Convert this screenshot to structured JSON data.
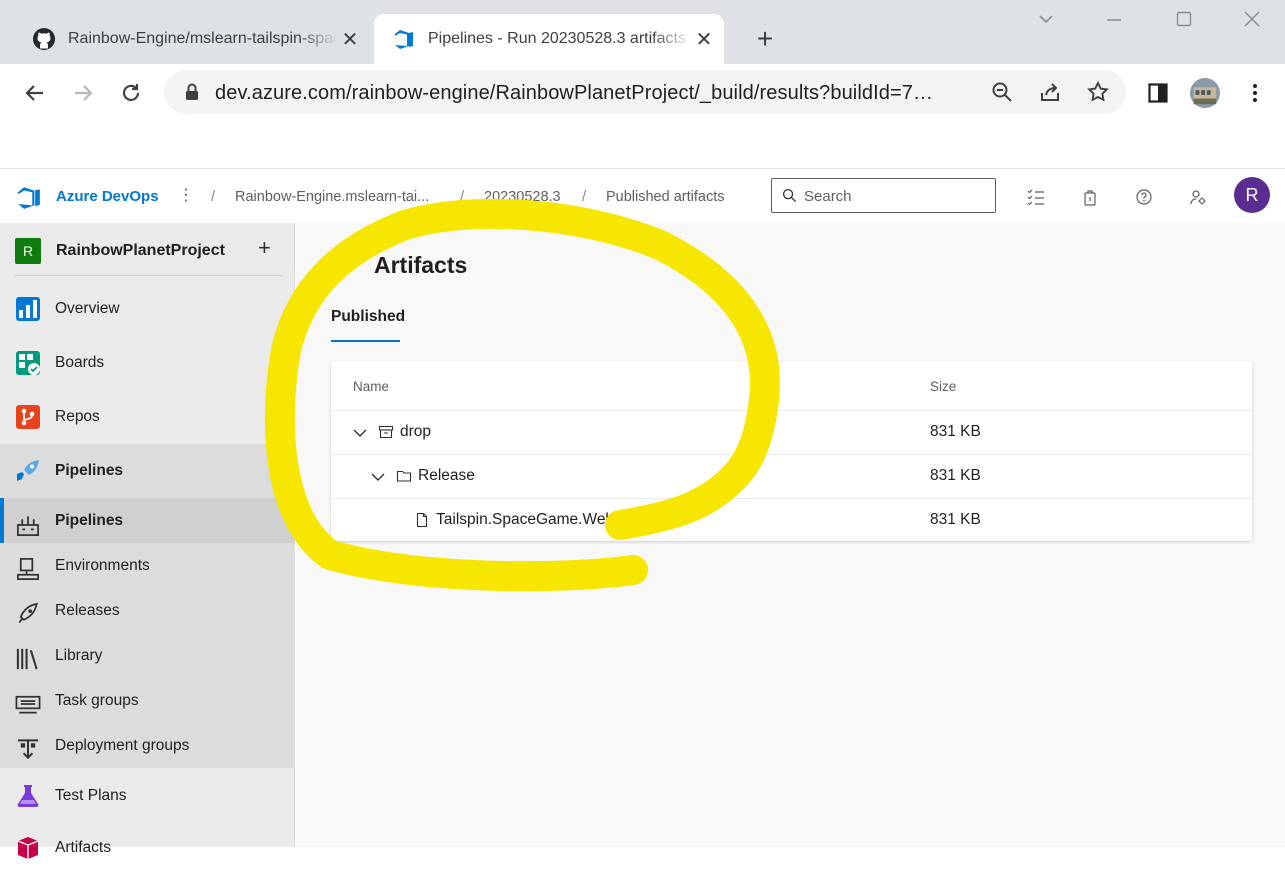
{
  "browser": {
    "tabs": [
      {
        "title": "Rainbow-Engine/mslearn-tailspin-spacegame-web",
        "close": "✕"
      },
      {
        "title": "Pipelines - Run 20230528.3 artifacts",
        "close": "✕"
      }
    ],
    "new_tab": "+",
    "url": "dev.azure.com/rainbow-engine/RainbowPlanetProject/_build/results?buildId=7…"
  },
  "header": {
    "brand": "Azure DevOps",
    "more": "⋮",
    "breadcrumbs": [
      "Rainbow-Engine.mslearn-tai...",
      "20230528.3",
      "Published artifacts"
    ],
    "separator": "/",
    "search_placeholder": "Search",
    "avatar_initial": "R"
  },
  "sidebar": {
    "project_initial": "R",
    "project_name": "RainbowPlanetProject",
    "project_add": "+",
    "items": [
      {
        "label": "Overview",
        "icon": "overview-icon"
      },
      {
        "label": "Boards",
        "icon": "boards-icon"
      },
      {
        "label": "Repos",
        "icon": "repos-icon"
      },
      {
        "label": "Pipelines",
        "icon": "pipelines-icon"
      },
      {
        "label": "Pipelines",
        "icon": "pipelines-sub-icon"
      },
      {
        "label": "Environments",
        "icon": "environments-icon"
      },
      {
        "label": "Releases",
        "icon": "releases-icon"
      },
      {
        "label": "Library",
        "icon": "library-icon"
      },
      {
        "label": "Task groups",
        "icon": "task-groups-icon"
      },
      {
        "label": "Deployment groups",
        "icon": "deployment-groups-icon"
      },
      {
        "label": "Test Plans",
        "icon": "test-plans-icon"
      },
      {
        "label": "Artifacts",
        "icon": "artifacts-icon"
      }
    ]
  },
  "main": {
    "title": "Artifacts",
    "tab": "Published",
    "columns": {
      "name": "Name",
      "size": "Size"
    },
    "rows": [
      {
        "name": "drop",
        "size": "831 KB",
        "icon": "artifact-box-icon",
        "expanded": true
      },
      {
        "name": "Release",
        "size": "831 KB",
        "icon": "folder-icon",
        "expanded": true
      },
      {
        "name": "Tailspin.SpaceGame.Web.zip",
        "size": "831 KB",
        "icon": "file-icon"
      }
    ]
  },
  "colors": {
    "accent": "#0078d4",
    "highlight": "#f7e600",
    "avatar": "#5c2d91",
    "project_badge": "#107c10"
  }
}
